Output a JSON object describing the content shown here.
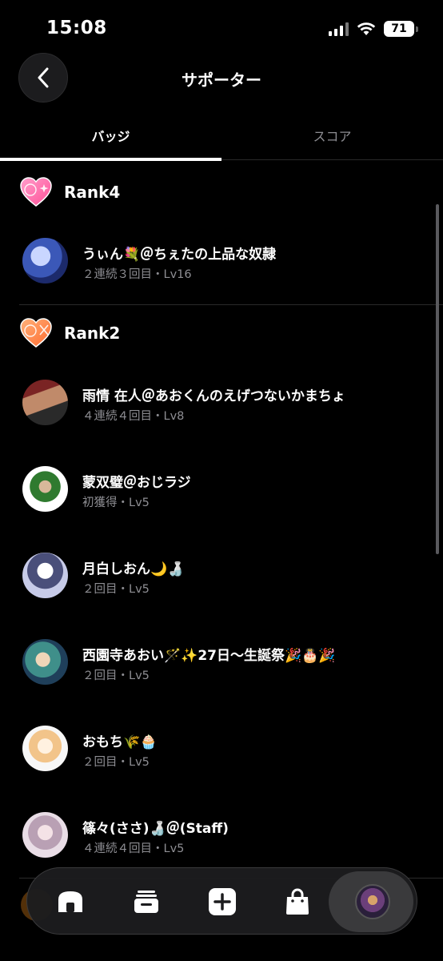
{
  "status_bar": {
    "time": "15:08",
    "battery": "71"
  },
  "header": {
    "title": "サポーター"
  },
  "tabs": [
    {
      "label": "バッジ",
      "active": true
    },
    {
      "label": "スコア",
      "active": false
    }
  ],
  "ranks": [
    {
      "badge_number": "4",
      "label": "Rank4",
      "badge_color": "#ff6fae",
      "supporters": [
        {
          "name": "うぃん💐＠ちぇたの上品な奴隷",
          "meta": "２連続３回目・Lv16"
        }
      ]
    },
    {
      "badge_number": "2",
      "label": "Rank2",
      "badge_color": "#ff8a4c",
      "supporters": [
        {
          "name": "雨情 在人＠あおくんのえげつないかまちょ",
          "meta": "４連続４回目・Lv8"
        },
        {
          "name": "蒙双璧＠おじラジ",
          "meta": "初獲得・Lv5"
        },
        {
          "name": "月白しおん🌙🍶",
          "meta": "２回目・Lv5"
        },
        {
          "name": "西園寺あおい🪄✨27日〜生誕祭🎉🎂🎉",
          "meta": "２回目・Lv5"
        },
        {
          "name": "おもち🌾🧁",
          "meta": "２回目・Lv5"
        },
        {
          "name": "篠々(ささ)🍶＠(Staff)",
          "meta": "４連続４回目・Lv5"
        }
      ]
    }
  ],
  "bottom_nav": [
    {
      "icon": "home-icon"
    },
    {
      "icon": "inbox-icon"
    },
    {
      "icon": "plus-icon"
    },
    {
      "icon": "bag-icon"
    },
    {
      "icon": "profile-avatar"
    }
  ],
  "colors": {
    "background": "#000000",
    "secondary_text": "#8e8e93",
    "nav_bg": "#1c1c1e"
  }
}
